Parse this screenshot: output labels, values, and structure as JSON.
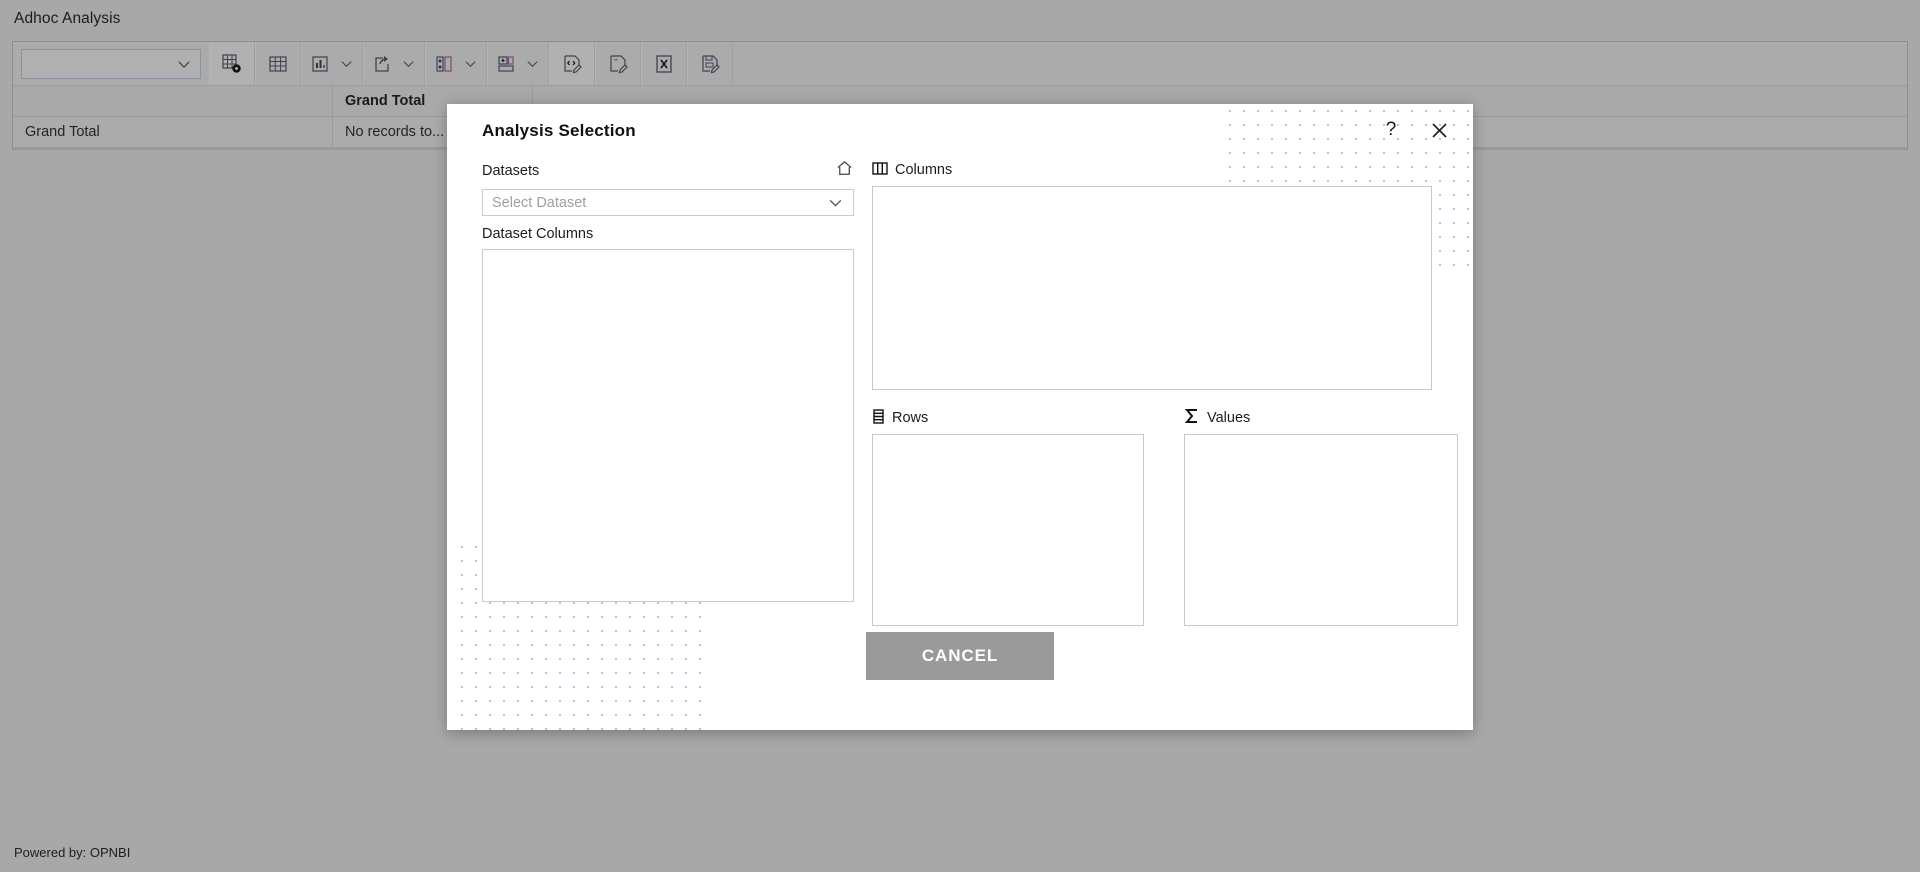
{
  "page": {
    "title": "Adhoc Analysis",
    "footer": "Powered by: OPNBI"
  },
  "toolbar": {
    "dataset_select_value": "",
    "buttons": [
      {
        "name": "pivot-settings",
        "icon": "table-gear-icon",
        "label": ""
      },
      {
        "name": "table-view",
        "icon": "table-grid-icon",
        "label": ""
      },
      {
        "name": "chart-menu",
        "icon": "bar-chart-icon",
        "label": "",
        "has_caret": true
      },
      {
        "name": "export-menu",
        "icon": "share-export-icon",
        "label": "",
        "has_caret": true
      },
      {
        "name": "add-column-menu",
        "icon": "add-column-icon",
        "label": "",
        "has_caret": true
      },
      {
        "name": "add-row-menu",
        "icon": "add-row-icon",
        "label": "",
        "has_caret": true
      },
      {
        "name": "edit-code",
        "icon": "code-edit-icon",
        "label": ""
      },
      {
        "name": "edit-note",
        "icon": "note-edit-icon",
        "label": ""
      },
      {
        "name": "export-excel",
        "icon": "excel-x-icon",
        "label": "X"
      },
      {
        "name": "save-report",
        "icon": "save-edit-icon",
        "label": ""
      }
    ]
  },
  "grid": {
    "headers": [
      "",
      "Grand Total"
    ],
    "rows": [
      {
        "label": "Grand Total",
        "value": "No records to..."
      }
    ]
  },
  "modal": {
    "title": "Analysis Selection",
    "help_icon": "?",
    "close_icon": "✕",
    "datasets": {
      "label": "Datasets",
      "home_icon": "home-icon",
      "select_placeholder": "Select Dataset",
      "select_value": "",
      "columns_label": "Dataset Columns",
      "columns_items": []
    },
    "columns_panel": {
      "label": "Columns",
      "icon": "columns-icon",
      "items": []
    },
    "rows_panel": {
      "label": "Rows",
      "icon": "rows-icon",
      "items": []
    },
    "values_panel": {
      "label": "Values",
      "icon": "sigma-icon",
      "items": []
    },
    "cancel_label": "CANCEL"
  },
  "colors": {
    "app_background": "#a8a8a8",
    "modal_background": "#ffffff",
    "cancel_button": "#9a9a9a",
    "dot_pattern": "#b9bfdd",
    "border": "#c9c9c9"
  }
}
